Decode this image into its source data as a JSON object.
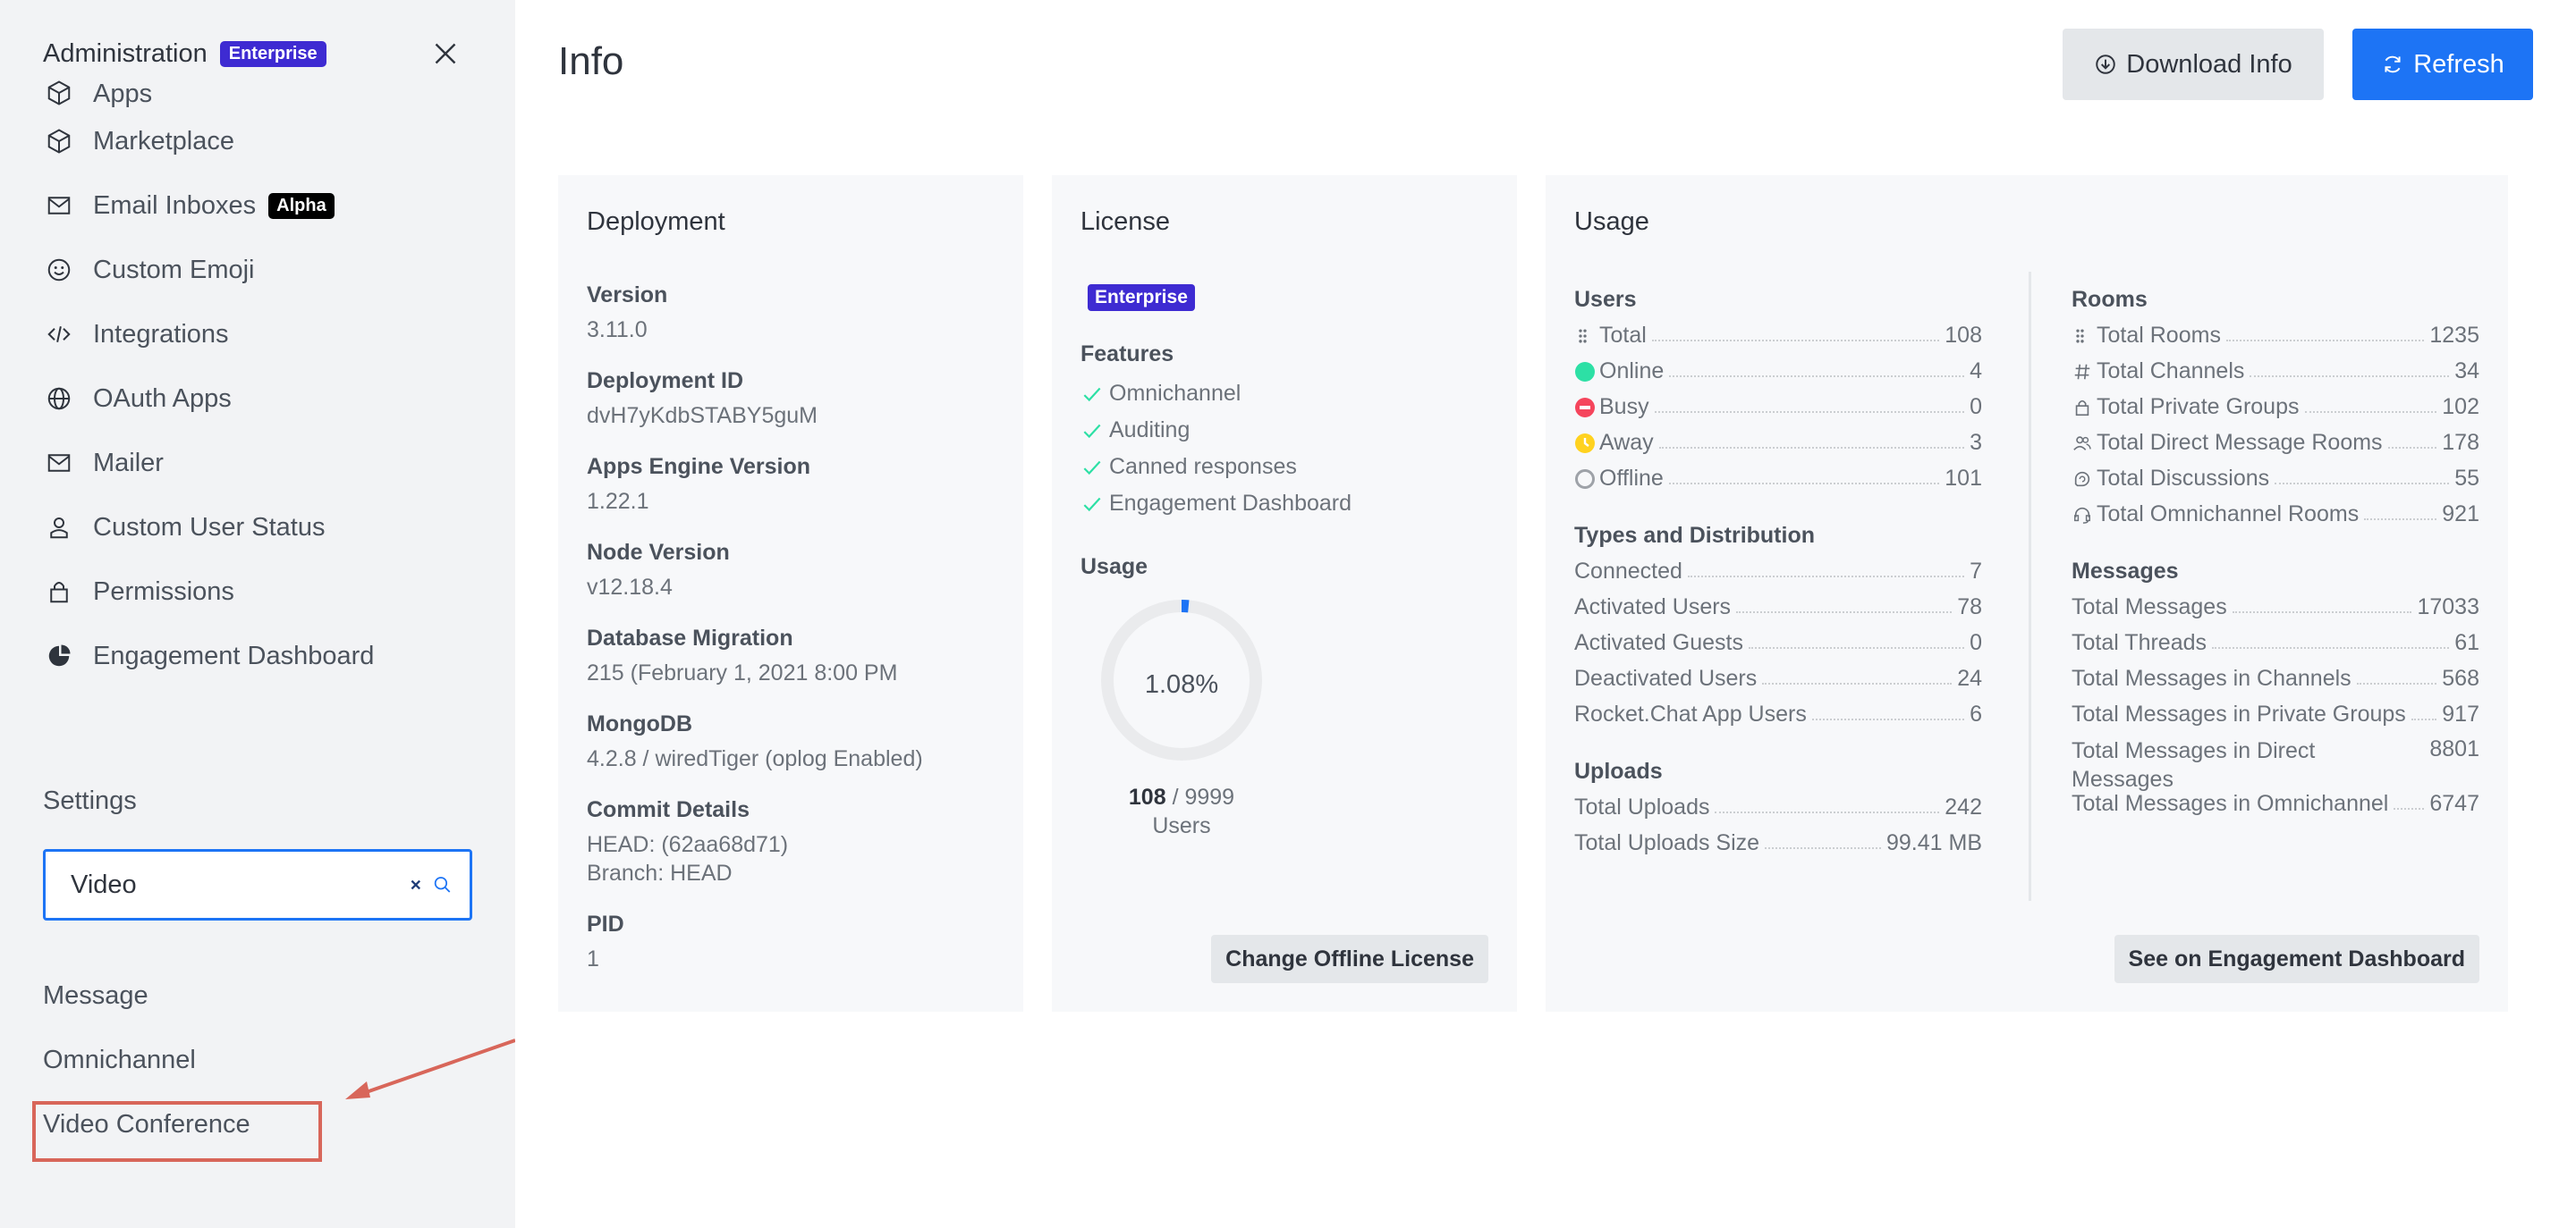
{
  "sidebar": {
    "title": "Administration",
    "title_badge": "Enterprise",
    "nav": [
      {
        "label": "Apps",
        "icon": "cube-icon"
      },
      {
        "label": "Marketplace",
        "icon": "cube-icon"
      },
      {
        "label": "Email Inboxes",
        "icon": "mail-icon",
        "badge": "Alpha"
      },
      {
        "label": "Custom Emoji",
        "icon": "emoji-icon"
      },
      {
        "label": "Integrations",
        "icon": "code-icon"
      },
      {
        "label": "OAuth Apps",
        "icon": "globe-icon"
      },
      {
        "label": "Mailer",
        "icon": "mail-icon"
      },
      {
        "label": "Custom User Status",
        "icon": "user-icon"
      },
      {
        "label": "Permissions",
        "icon": "lock-icon"
      },
      {
        "label": "Engagement Dashboard",
        "icon": "pie-chart-icon"
      }
    ],
    "settings_label": "Settings",
    "search": {
      "value": "Video",
      "placeholder": "Search"
    },
    "results": [
      "Message",
      "Omnichannel",
      "Video Conference"
    ]
  },
  "header": {
    "title": "Info",
    "download_label": "Download Info",
    "refresh_label": "Refresh"
  },
  "deployment": {
    "title": "Deployment",
    "items": [
      {
        "label": "Version",
        "value": "3.11.0"
      },
      {
        "label": "Deployment ID",
        "value": "dvH7yKdbSTABY5guM"
      },
      {
        "label": "Apps Engine Version",
        "value": "1.22.1"
      },
      {
        "label": "Node Version",
        "value": "v12.18.4"
      },
      {
        "label": "Database Migration",
        "value": "215 (February 1, 2021 8:00 PM"
      },
      {
        "label": "MongoDB",
        "value": "4.2.8 / wiredTiger (oplog Enabled)"
      },
      {
        "label": "Commit Details",
        "value": "HEAD: (62aa68d71)",
        "value2": "Branch: HEAD"
      },
      {
        "label": "PID",
        "value": "1"
      }
    ]
  },
  "license": {
    "title": "License",
    "badge": "Enterprise",
    "features_label": "Features",
    "features": [
      "Omnichannel",
      "Auditing",
      "Canned responses",
      "Engagement Dashboard"
    ],
    "usage_label": "Usage",
    "usage_percent_text": "1.08%",
    "usage_fraction": 0.0108,
    "users_used": "108",
    "users_separator": " / 9999",
    "users_label": "Users",
    "change_button": "Change Offline License",
    "accent_color": "#1d74f5"
  },
  "usage": {
    "title": "Usage",
    "users_title": "Users",
    "users": [
      {
        "label": "Total",
        "value": "108",
        "icon": "grid-icon"
      },
      {
        "label": "Online",
        "value": "4",
        "icon": "online-status-icon",
        "color": "#2de0a5"
      },
      {
        "label": "Busy",
        "value": "0",
        "icon": "busy-status-icon",
        "color": "#f5455c"
      },
      {
        "label": "Away",
        "value": "3",
        "icon": "away-status-icon",
        "color": "#ffd21f"
      },
      {
        "label": "Offline",
        "value": "101",
        "icon": "offline-status-icon",
        "color": "#cbced1"
      }
    ],
    "types_title": "Types and Distribution",
    "types": [
      {
        "label": "Connected",
        "value": "7"
      },
      {
        "label": "Activated Users",
        "value": "78"
      },
      {
        "label": "Activated Guests",
        "value": "0"
      },
      {
        "label": "Deactivated Users",
        "value": "24"
      },
      {
        "label": "Rocket.Chat App Users",
        "value": "6"
      }
    ],
    "uploads_title": "Uploads",
    "uploads": [
      {
        "label": "Total Uploads",
        "value": "242"
      },
      {
        "label": "Total Uploads Size",
        "value": "99.41 MB"
      }
    ],
    "rooms_title": "Rooms",
    "rooms": [
      {
        "label": "Total Rooms",
        "value": "1235",
        "icon": "grid-icon"
      },
      {
        "label": "Total Channels",
        "value": "34",
        "icon": "hashtag-icon"
      },
      {
        "label": "Total Private Groups",
        "value": "102",
        "icon": "lock-icon"
      },
      {
        "label": "Total Direct Message Rooms",
        "value": "178",
        "icon": "team-icon"
      },
      {
        "label": "Total Discussions",
        "value": "55",
        "icon": "discussion-icon"
      },
      {
        "label": "Total Omnichannel Rooms",
        "value": "921",
        "icon": "headset-icon"
      }
    ],
    "messages_title": "Messages",
    "messages": [
      {
        "label": "Total Messages",
        "value": "17033"
      },
      {
        "label": "Total Threads",
        "value": "61"
      },
      {
        "label": "Total Messages in Channels",
        "value": "568"
      },
      {
        "label": "Total Messages in Private Groups",
        "value": "917"
      },
      {
        "label": "Total Messages in Direct Messages",
        "value": "8801"
      },
      {
        "label": "Total Messages in Omnichannel",
        "value": "6747"
      }
    ],
    "engagement_button": "See on Engagement Dashboard"
  }
}
